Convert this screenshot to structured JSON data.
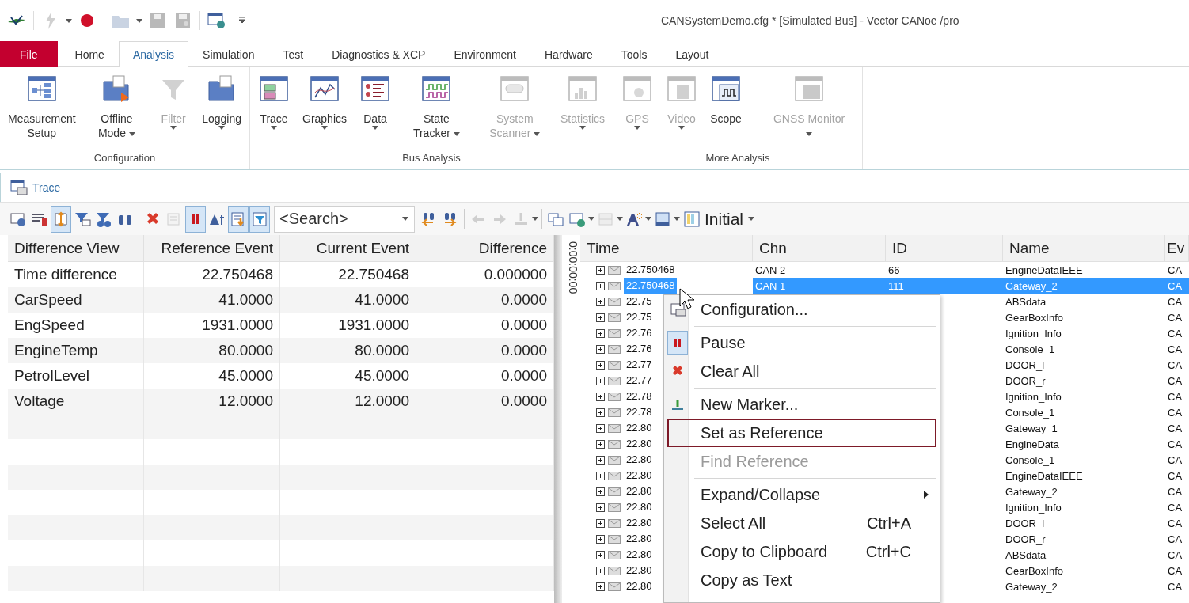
{
  "window": {
    "title": "CANSystemDemo.cfg * [Simulated Bus] - Vector CANoe /pro"
  },
  "ribbon_tabs": [
    {
      "label": "File",
      "kind": "file",
      "selected": false
    },
    {
      "label": "Home",
      "kind": "tab",
      "selected": false
    },
    {
      "label": "Analysis",
      "kind": "tab",
      "selected": true
    },
    {
      "label": "Simulation",
      "kind": "tab",
      "selected": false
    },
    {
      "label": "Test",
      "kind": "tab",
      "selected": false
    },
    {
      "label": "Diagnostics & XCP",
      "kind": "tab",
      "selected": false
    },
    {
      "label": "Environment",
      "kind": "tab",
      "selected": false
    },
    {
      "label": "Hardware",
      "kind": "tab",
      "selected": false
    },
    {
      "label": "Tools",
      "kind": "tab",
      "selected": false
    },
    {
      "label": "Layout",
      "kind": "tab",
      "selected": false
    }
  ],
  "ribbon_groups": [
    {
      "label": "Configuration",
      "buttons": [
        {
          "label": "Measurement Setup",
          "dropdown": false,
          "disabled": false
        },
        {
          "label": "Offline Mode",
          "dropdown": true,
          "disabled": false
        },
        {
          "label": "Filter",
          "dropdown": true,
          "disabled": true
        },
        {
          "label": "Logging",
          "dropdown": true,
          "disabled": false
        }
      ]
    },
    {
      "label": "Bus Analysis",
      "buttons": [
        {
          "label": "Trace",
          "dropdown": true,
          "disabled": false
        },
        {
          "label": "Graphics",
          "dropdown": true,
          "disabled": false
        },
        {
          "label": "Data",
          "dropdown": true,
          "disabled": false
        },
        {
          "label": "State Tracker",
          "dropdown": true,
          "disabled": false
        },
        {
          "label": "System Scanner",
          "dropdown": true,
          "disabled": true
        },
        {
          "label": "Statistics",
          "dropdown": true,
          "disabled": true
        }
      ]
    },
    {
      "label": "More Analysis",
      "buttons": [
        {
          "label": "GPS",
          "dropdown": true,
          "disabled": true
        },
        {
          "label": "Video",
          "dropdown": true,
          "disabled": true
        },
        {
          "label": "Scope",
          "dropdown": false,
          "disabled": false
        },
        {
          "label": "GNSS Monitor",
          "dropdown": true,
          "disabled": true
        }
      ]
    }
  ],
  "trace": {
    "title": "Trace",
    "toolbar": {
      "buttons": [
        {
          "pressed": false,
          "disabled": false
        },
        {
          "pressed": false,
          "disabled": false
        },
        {
          "pressed": true,
          "disabled": false
        },
        {
          "pressed": false,
          "disabled": false
        },
        {
          "pressed": false,
          "disabled": false
        },
        {
          "pressed": false,
          "disabled": false
        },
        {
          "pressed": false,
          "disabled": false
        },
        {
          "pressed": false,
          "disabled": true
        },
        {
          "pressed": true,
          "disabled": false
        },
        {
          "pressed": false,
          "disabled": false
        },
        {
          "pressed": true,
          "disabled": false
        },
        {
          "pressed": true,
          "disabled": false
        },
        {
          "pressed": false,
          "disabled": false
        },
        {
          "pressed": false,
          "disabled": false
        },
        {
          "pressed": false,
          "disabled": true
        },
        {
          "pressed": false,
          "disabled": true
        },
        {
          "pressed": false,
          "disabled": true
        },
        {
          "pressed": false,
          "disabled": false
        },
        {
          "pressed": false,
          "disabled": false
        },
        {
          "pressed": false,
          "disabled": true
        },
        {
          "pressed": false,
          "disabled": false
        },
        {
          "pressed": false,
          "disabled": false
        }
      ],
      "search": {
        "placeholder": "<Search>"
      },
      "layout": "Initial"
    },
    "difference_table": {
      "columns": [
        "Difference View",
        "Reference Event",
        "Current Event",
        "Difference"
      ],
      "rows": [
        [
          "Time difference",
          "22.750468",
          "22.750468",
          "0.000000"
        ],
        [
          "CarSpeed",
          "41.0000",
          "41.0000",
          "0.0000"
        ],
        [
          "EngSpeed",
          "1931.0000",
          "1931.0000",
          "0.0000"
        ],
        [
          "EngineTemp",
          "80.0000",
          "80.0000",
          "0.0000"
        ],
        [
          "PetrolLevel",
          "45.0000",
          "45.0000",
          "0.0000"
        ],
        [
          "Voltage",
          "12.0000",
          "12.0000",
          "0.0000"
        ]
      ]
    },
    "splitter_label": "0:00:00:00",
    "trace_table": {
      "columns": [
        "Time",
        "Chn",
        "ID",
        "Name",
        "Ev"
      ],
      "rows": [
        {
          "time": "22.750468",
          "chn": "CAN 2",
          "id": "66",
          "name": "EngineDataIEEE",
          "ev": "CA",
          "selected": false
        },
        {
          "time": "22.750468",
          "chn": "CAN 1",
          "id": "111",
          "name": "Gateway_2",
          "ev": "CA",
          "selected": true
        },
        {
          "time": "22.75",
          "name": "ABSdata",
          "ev": "CA",
          "selected": false
        },
        {
          "time": "22.75",
          "name": "GearBoxInfo",
          "ev": "CA",
          "selected": false
        },
        {
          "time": "22.76",
          "name": "Ignition_Info",
          "ev": "CA",
          "selected": false
        },
        {
          "time": "22.76",
          "name": "Console_1",
          "ev": "CA",
          "selected": false
        },
        {
          "time": "22.77",
          "name": "DOOR_l",
          "ev": "CA",
          "selected": false
        },
        {
          "time": "22.77",
          "name": "DOOR_r",
          "ev": "CA",
          "selected": false
        },
        {
          "time": "22.78",
          "name": "Ignition_Info",
          "ev": "CA",
          "selected": false
        },
        {
          "time": "22.78",
          "name": "Console_1",
          "ev": "CA",
          "selected": false
        },
        {
          "time": "22.80",
          "name": "Gateway_1",
          "ev": "CA",
          "selected": false
        },
        {
          "time": "22.80",
          "name": "EngineData",
          "ev": "CA",
          "selected": false
        },
        {
          "time": "22.80",
          "name": "Console_1",
          "ev": "CA",
          "selected": false
        },
        {
          "time": "22.80",
          "name": "EngineDataIEEE",
          "ev": "CA",
          "selected": false
        },
        {
          "time": "22.80",
          "name": "Gateway_2",
          "ev": "CA",
          "selected": false
        },
        {
          "time": "22.80",
          "name": "Ignition_Info",
          "ev": "CA",
          "selected": false
        },
        {
          "time": "22.80",
          "name": "DOOR_l",
          "ev": "CA",
          "selected": false
        },
        {
          "time": "22.80",
          "name": "DOOR_r",
          "ev": "CA",
          "selected": false
        },
        {
          "time": "22.80",
          "name": "ABSdata",
          "ev": "CA",
          "selected": false
        },
        {
          "time": "22.80",
          "name": "GearBoxInfo",
          "ev": "CA",
          "selected": false
        },
        {
          "time": "22.80",
          "name": "Gateway_2",
          "ev": "CA",
          "selected": false
        }
      ]
    }
  },
  "context_menu": {
    "items": [
      {
        "kind": "item",
        "label": "Configuration...",
        "checked": false,
        "disabled": false,
        "selected": false
      },
      {
        "kind": "separator"
      },
      {
        "kind": "item",
        "label": "Pause",
        "checked": true,
        "disabled": false,
        "selected": false
      },
      {
        "kind": "item",
        "label": "Clear All",
        "checked": false,
        "disabled": false,
        "selected": false
      },
      {
        "kind": "separator"
      },
      {
        "kind": "item",
        "label": "New Marker...",
        "checked": false,
        "disabled": false,
        "selected": false
      },
      {
        "kind": "item",
        "label": "Set as Reference",
        "checked": false,
        "disabled": false,
        "selected": true
      },
      {
        "kind": "item",
        "label": "Find Reference",
        "checked": false,
        "disabled": true,
        "selected": false
      },
      {
        "kind": "separator"
      },
      {
        "kind": "item",
        "label": "Expand/Collapse",
        "submenu": true,
        "checked": false,
        "disabled": false,
        "selected": false
      },
      {
        "kind": "item",
        "label": "Select All",
        "shortcut": "Ctrl+A",
        "checked": false,
        "disabled": false,
        "selected": false
      },
      {
        "kind": "item",
        "label": "Copy to Clipboard",
        "shortcut": "Ctrl+C",
        "checked": false,
        "disabled": false,
        "selected": false
      },
      {
        "kind": "item",
        "label": "Copy as Text",
        "checked": false,
        "disabled": false,
        "selected": false
      }
    ]
  }
}
